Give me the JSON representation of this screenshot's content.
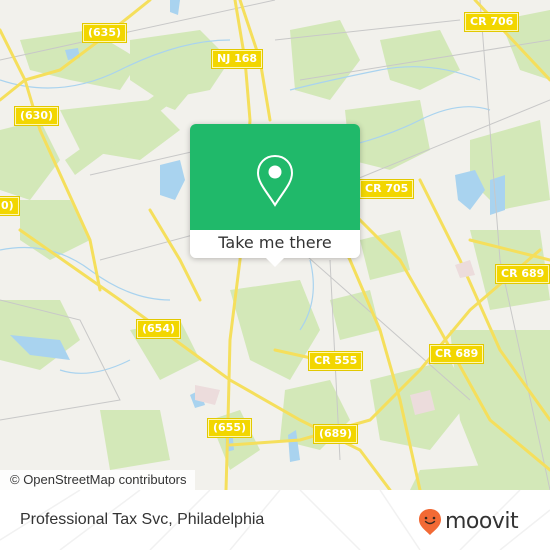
{
  "map": {
    "attribution": "© OpenStreetMap contributors",
    "road_labels": [
      {
        "text": "(635)",
        "name": "road-label-635"
      },
      {
        "text": "NJ 168",
        "name": "road-label-nj168"
      },
      {
        "text": "CR 706",
        "name": "road-label-cr706"
      },
      {
        "text": "(630)",
        "name": "road-label-630"
      },
      {
        "text": "0)",
        "name": "road-label-edge"
      },
      {
        "text": "CR 705",
        "name": "road-label-cr705"
      },
      {
        "text": "CR 689",
        "name": "road-label-cr689-east"
      },
      {
        "text": "(654)",
        "name": "road-label-654"
      },
      {
        "text": "CR 689",
        "name": "road-label-cr689"
      },
      {
        "text": "CR 555",
        "name": "road-label-cr555"
      },
      {
        "text": "(655)",
        "name": "road-label-655"
      },
      {
        "text": "(689)",
        "name": "road-label-689"
      }
    ],
    "colors": {
      "land": "#f2f1ec",
      "forest": "#cfe6b1",
      "water": "#a9d3ef",
      "road": "#f5df5c",
      "road_label_bg": "#f2d600"
    }
  },
  "popup": {
    "icon": "location-pin-icon",
    "button_label": "Take me there",
    "color": "#20b96a"
  },
  "footer": {
    "place_name": "Professional Tax Svc, Philadelphia",
    "brand": "moovit",
    "brand_icon": "moovit-pin-smile-icon",
    "brand_color": "#f26a35"
  }
}
